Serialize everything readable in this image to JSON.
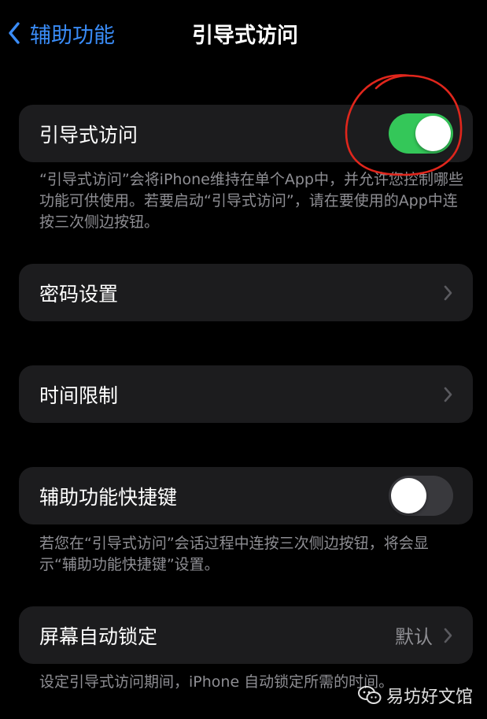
{
  "nav": {
    "back_label": "辅助功能",
    "title": "引导式访问"
  },
  "guided_access": {
    "label": "引导式访问",
    "enabled": true,
    "description": "“引导式访问”会将iPhone维持在单个App中，并允许您控制哪些功能可供使用。若要启动“引导式访问”，请在要使用的App中连按三次侧边按钮。"
  },
  "passcode": {
    "label": "密码设置"
  },
  "time_limits": {
    "label": "时间限制"
  },
  "accessibility_shortcut": {
    "label": "辅助功能快捷键",
    "enabled": false,
    "description": "若您在“引导式访问”会话过程中连按三次侧边按钮，将会显示“辅助功能快捷键”设置。"
  },
  "auto_lock": {
    "label": "屏幕自动锁定",
    "value": "默认",
    "description": "设定引导式访问期间，iPhone 自动锁定所需的时间。"
  },
  "watermark": {
    "text": "易坊好文馆"
  },
  "colors": {
    "accent": "#3a8cf7",
    "toggle_on": "#34c759",
    "toggle_off": "#39393d",
    "cell_bg": "#1c1c1e",
    "annotation": "#e0261c"
  }
}
